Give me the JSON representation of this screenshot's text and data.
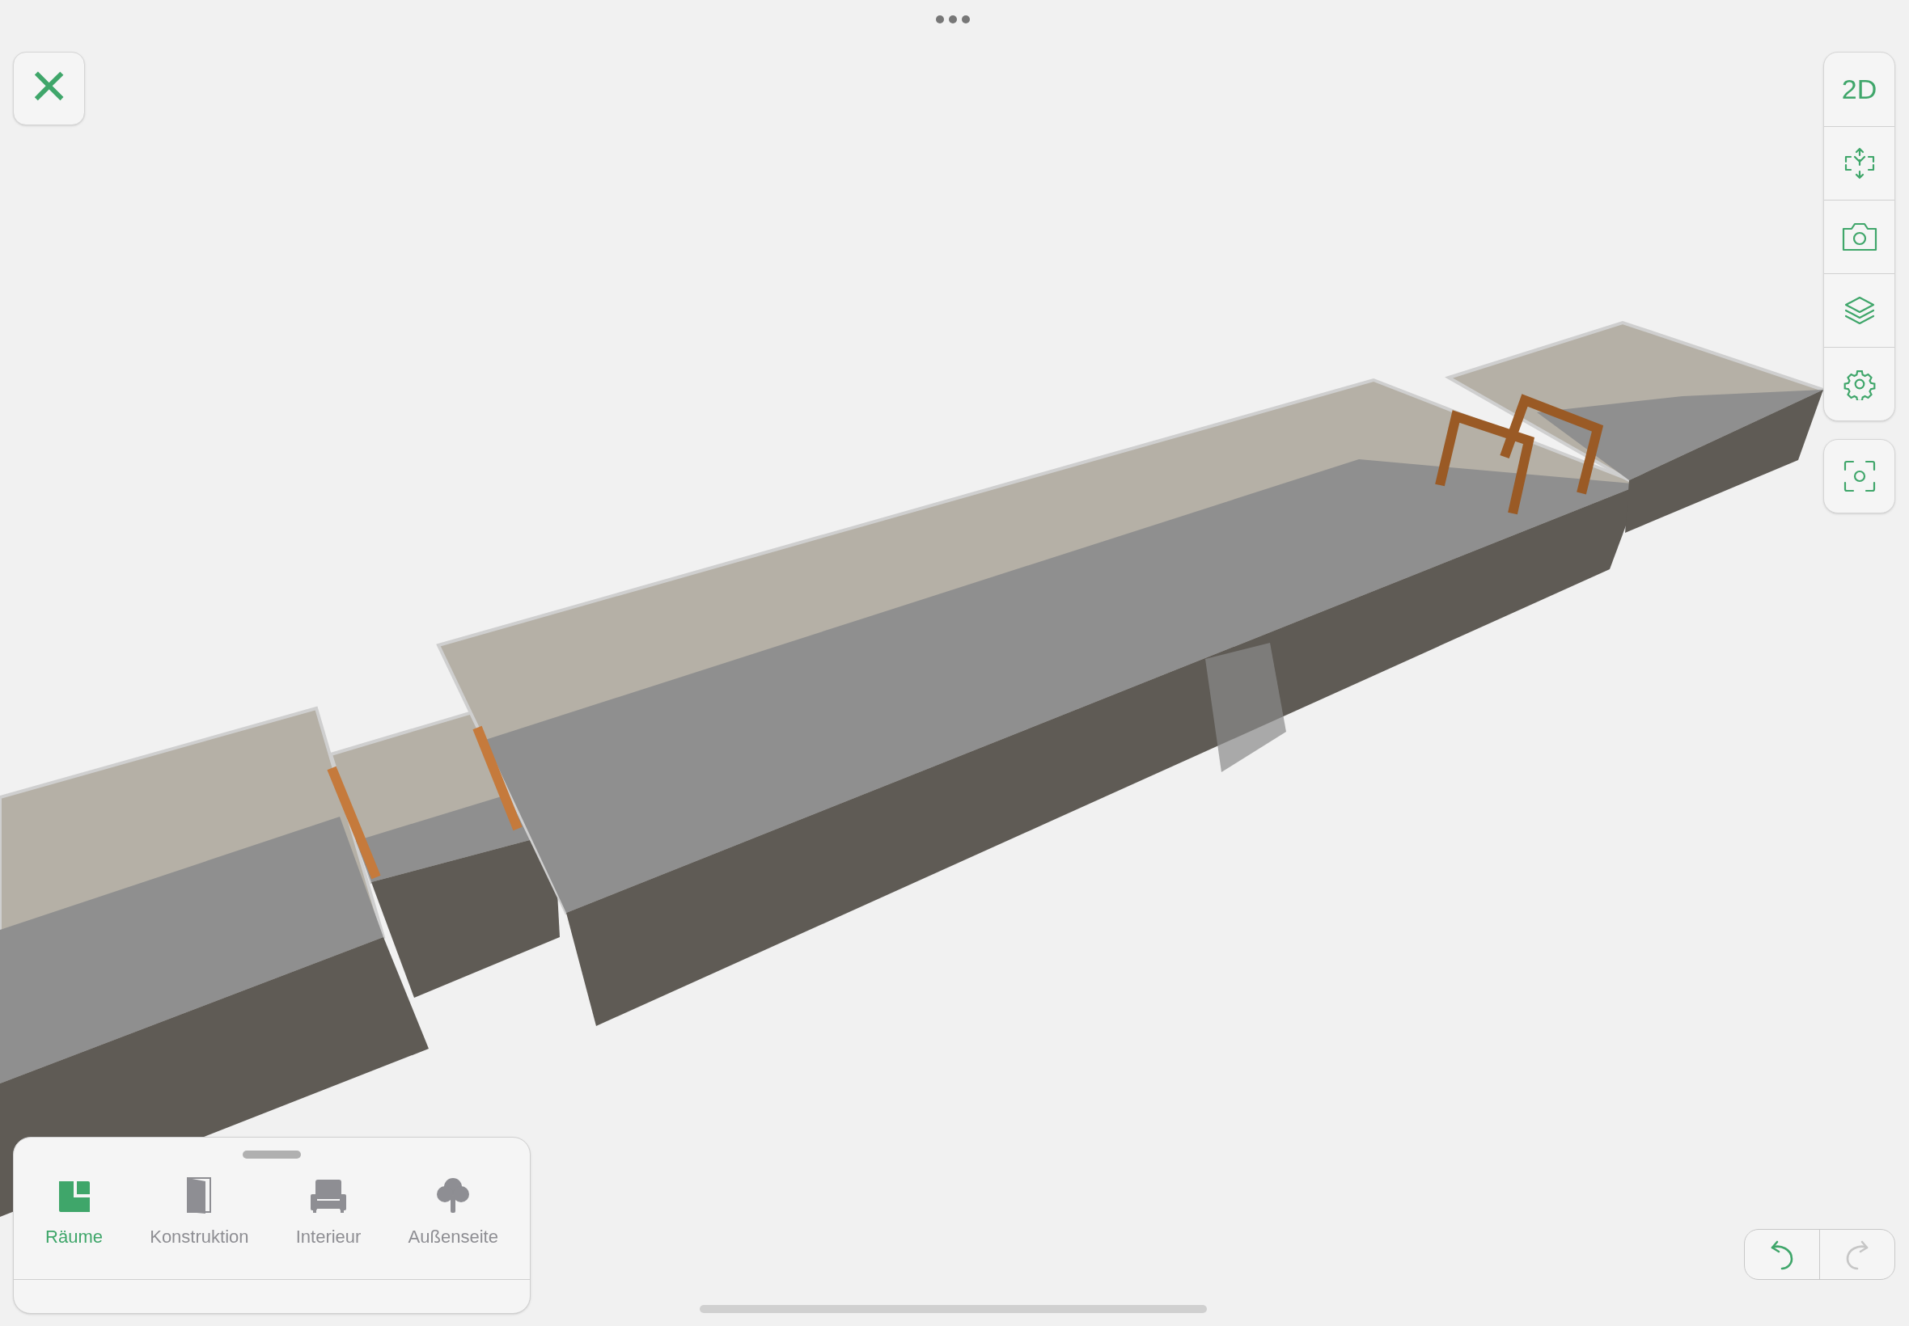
{
  "close_button": {
    "label": "×"
  },
  "view_toolbar": [
    {
      "kind": "text",
      "label": "2D"
    },
    {
      "kind": "move"
    },
    {
      "kind": "camera"
    },
    {
      "kind": "layers"
    },
    {
      "kind": "settings"
    }
  ],
  "focus_button": {
    "kind": "focus"
  },
  "category_tabs": [
    {
      "label": "Räume",
      "kind": "rooms",
      "selected": true
    },
    {
      "label": "Konstruktion",
      "kind": "door",
      "selected": false
    },
    {
      "label": "Interieur",
      "kind": "armchair",
      "selected": false
    },
    {
      "label": "Außenseite",
      "kind": "tree",
      "selected": false
    }
  ],
  "history": [
    {
      "kind": "undo",
      "disabled": false
    },
    {
      "kind": "redo",
      "disabled": true
    }
  ]
}
